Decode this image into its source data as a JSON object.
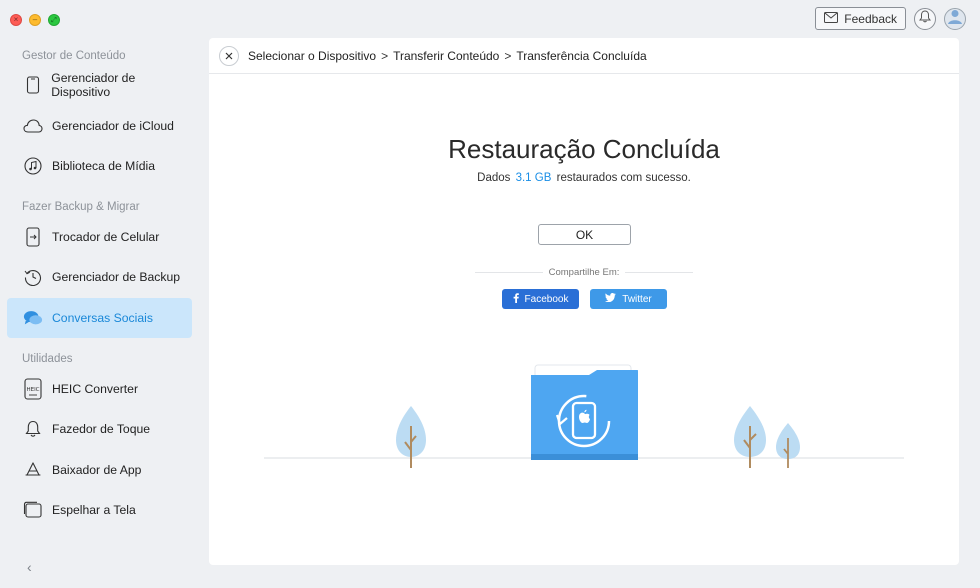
{
  "window": {
    "buttons": {
      "close": "×",
      "minimize": "–",
      "zoom": "⤢"
    }
  },
  "topbar": {
    "feedback_label": "Feedback"
  },
  "sidebar": {
    "sections": [
      {
        "title": "Gestor de Conteúdo"
      },
      {
        "title": "Fazer Backup & Migrar"
      },
      {
        "title": "Utilidades"
      }
    ],
    "items": [
      {
        "label": "Gerenciador de Dispositivo",
        "icon": "device-icon"
      },
      {
        "label": "Gerenciador de iCloud",
        "icon": "cloud-icon"
      },
      {
        "label": "Biblioteca de Mídia",
        "icon": "music-icon"
      },
      {
        "label": "Trocador de Celular",
        "icon": "phone-switch-icon"
      },
      {
        "label": "Gerenciador de Backup",
        "icon": "backup-clock-icon"
      },
      {
        "label": "Conversas Sociais",
        "icon": "chat-bubbles-icon",
        "active": true
      },
      {
        "label": "HEIC Converter",
        "icon": "heic-icon"
      },
      {
        "label": "Fazedor de Toque",
        "icon": "bell-icon"
      },
      {
        "label": "Baixador de App",
        "icon": "app-store-icon"
      },
      {
        "label": "Espelhar a Tela",
        "icon": "screen-mirror-icon"
      }
    ],
    "collapse_glyph": "‹"
  },
  "breadcrumb": {
    "items": [
      "Selecionar o Dispositivo",
      "Transferir Conteúdo",
      "Transferência Concluída"
    ],
    "separator": ">"
  },
  "result": {
    "title": "Restauração Concluída",
    "sub_prefix": "Dados",
    "sub_size": "3.1 GB",
    "sub_suffix": "restaurados com sucesso.",
    "ok_label": "OK",
    "share_label": "Compartilhe Em:",
    "facebook_label": "Facebook",
    "twitter_label": "Twitter"
  },
  "colors": {
    "accent": "#1a8ee6",
    "active_bg": "#cbe6fb",
    "facebook": "#2a6fd6",
    "twitter": "#3e99e8",
    "folder": "#4ea6f1"
  }
}
